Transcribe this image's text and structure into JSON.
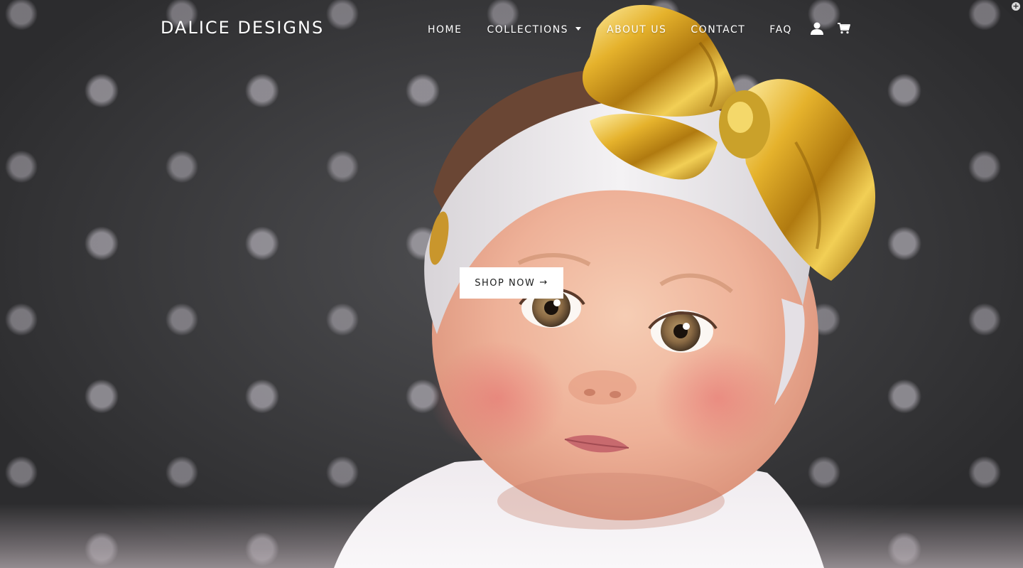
{
  "brand": {
    "name": "DALICE DESIGNS"
  },
  "nav": {
    "items": [
      {
        "label": "HOME"
      },
      {
        "label": "COLLECTIONS"
      },
      {
        "label": "ABOUT US"
      },
      {
        "label": "CONTACT"
      },
      {
        "label": "FAQ"
      }
    ],
    "account_icon": "user-icon",
    "cart_icon": "cart-icon"
  },
  "hero": {
    "cta_label": "SHOP NOW",
    "cta_arrow": "→",
    "image": "baby-with-gold-bow-headband"
  },
  "corner": {
    "icon": "plus-circle-icon",
    "glyph": "+"
  },
  "colors": {
    "header_text": "#ffffff",
    "cta_bg": "#ffffff",
    "cta_text": "#1c1d1d",
    "bow_gold": "#d9a520"
  }
}
